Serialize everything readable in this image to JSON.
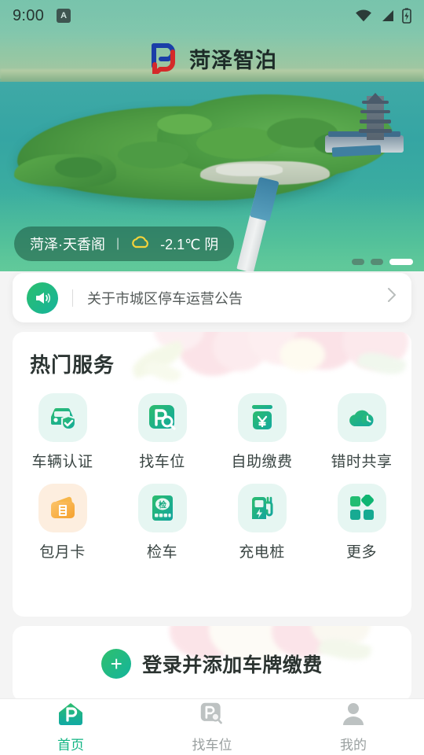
{
  "status_bar": {
    "time": "9:00",
    "badge_letter": "A",
    "icons": [
      "wifi-icon",
      "cellular-signal-icon",
      "battery-charging-icon"
    ]
  },
  "header": {
    "app_title": "菏泽智泊",
    "logo_icon": "hz-parking-logo"
  },
  "banner": {
    "weather": {
      "location": "菏泽·天香阁",
      "divider": "|",
      "icon": "cloudy-icon",
      "temperature": "-2.1℃ 阴"
    },
    "carousel": {
      "total": 3,
      "active_index": 3
    }
  },
  "announcement": {
    "icon": "megaphone-icon",
    "text": "关于市城区停车运营公告",
    "chevron": "chevron-right-icon"
  },
  "services": {
    "title": "热门服务",
    "items": [
      {
        "label": "车辆认证",
        "icon": "car-verify-icon",
        "tile": "mint"
      },
      {
        "label": "找车位",
        "icon": "parking-search-icon",
        "tile": "mint"
      },
      {
        "label": "自助缴费",
        "icon": "yuan-payment-icon",
        "tile": "mint"
      },
      {
        "label": "错时共享",
        "icon": "cloud-clock-icon",
        "tile": "mint"
      },
      {
        "label": "包月卡",
        "icon": "monthly-card-icon",
        "tile": "orange"
      },
      {
        "label": "检车",
        "icon": "vehicle-inspection-icon",
        "tile": "mint"
      },
      {
        "label": "充电桩",
        "icon": "charging-pile-icon",
        "tile": "mint"
      },
      {
        "label": "更多",
        "icon": "more-grid-icon",
        "tile": "mint"
      }
    ]
  },
  "plate_card": {
    "plus_icon": "plus-circle-icon",
    "text": "登录并添加车牌缴费"
  },
  "tabbar": {
    "tabs": [
      {
        "label": "首页",
        "icon": "home-parking-icon",
        "active": true
      },
      {
        "label": "找车位",
        "icon": "parking-search-icon",
        "active": false
      },
      {
        "label": "我的",
        "icon": "person-icon",
        "active": false
      }
    ]
  },
  "colors": {
    "brand_green": "#12b583",
    "brand_teal": "#16b39b",
    "accent_orange": "#f7a93b",
    "tile_mint": "#e6f6f2",
    "tile_orange": "#fdeedf",
    "page_bg": "#f4f4f4",
    "text_primary": "#2c3533",
    "text_secondary": "#9aa0a0"
  }
}
